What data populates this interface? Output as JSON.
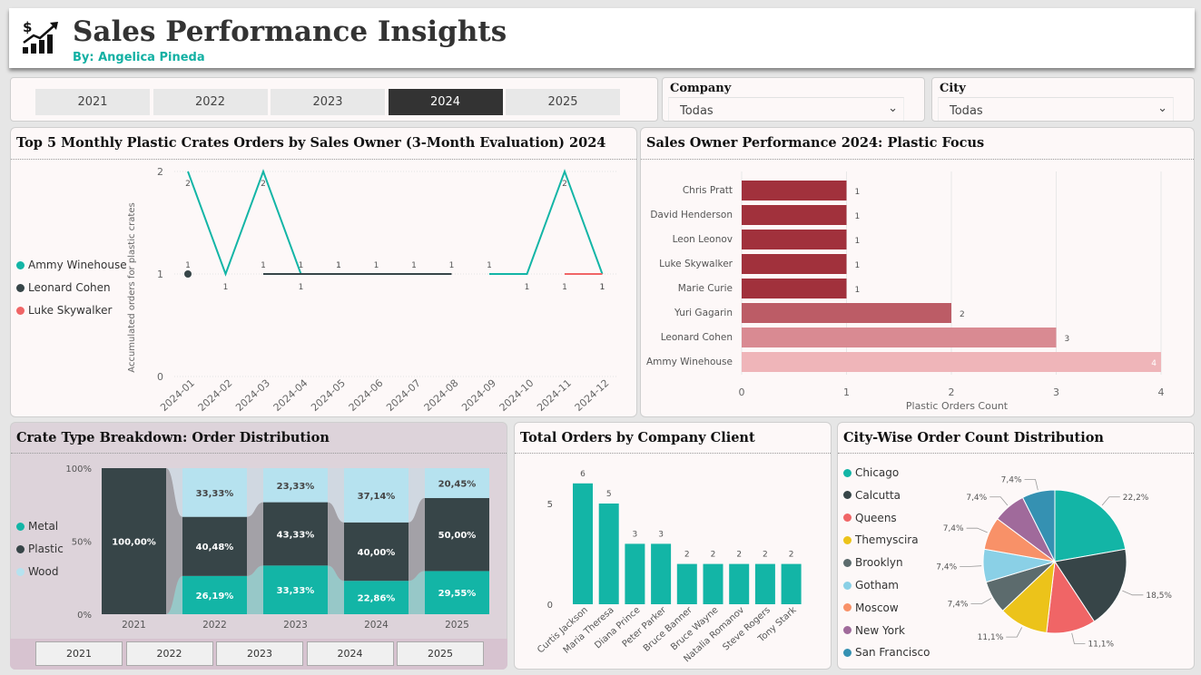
{
  "header": {
    "title": "Sales Performance Insights",
    "subtitle": "By: Angelica Pineda",
    "logo_icon": "sales-growth-icon"
  },
  "year_slicer": {
    "years": [
      "2021",
      "2022",
      "2023",
      "2024",
      "2025"
    ],
    "selected": "2024"
  },
  "company_filter": {
    "label": "Company",
    "value": "Todas"
  },
  "city_filter": {
    "label": "City",
    "value": "Todas"
  },
  "colors": {
    "teal": "#13b5a6",
    "dark": "#374548",
    "coral": "#f06566",
    "bar_dark": "#a1313c",
    "bar_mid": "#bc5c66",
    "bar_light": "#d98a92",
    "bar_lightest": "#efb5b9"
  },
  "line_panel": {
    "title": "Top 5 Monthly Plastic Crates Orders by Sales Owner (3-Month Evaluation) 2024",
    "legend": [
      {
        "name": "Ammy Winehouse",
        "color": "#13b5a6"
      },
      {
        "name": "Leonard Cohen",
        "color": "#374548"
      },
      {
        "name": "Luke Skywalker",
        "color": "#f06566"
      }
    ],
    "chart_data": {
      "type": "line",
      "x": [
        "2024-01",
        "2024-02",
        "2024-03",
        "2024-04",
        "2024-05",
        "2024-06",
        "2024-07",
        "2024-08",
        "2024-09",
        "2024-10",
        "2024-11",
        "2024-12"
      ],
      "ylabel": "Accumulated orders for plastic crates",
      "yticks": [
        "0",
        "1",
        "2"
      ],
      "ylim": [
        0,
        2
      ],
      "series": [
        {
          "name": "Ammy Winehouse",
          "values": [
            2,
            1,
            2,
            1,
            1,
            null,
            null,
            null,
            1,
            1,
            2,
            1
          ]
        },
        {
          "name": "Leonard Cohen",
          "values": [
            1,
            null,
            1,
            1,
            1,
            1,
            1,
            1,
            null,
            null,
            null,
            null
          ]
        },
        {
          "name": "Luke Skywalker",
          "values": [
            null,
            null,
            null,
            null,
            null,
            null,
            null,
            null,
            null,
            null,
            1,
            1
          ]
        }
      ]
    }
  },
  "bar_panel": {
    "title": "Sales Owner Performance 2024: Plastic Focus",
    "chart_data": {
      "type": "bar",
      "categories": [
        "Chris Pratt",
        "David Henderson",
        "Leon Leonov",
        "Luke Skywalker",
        "Marie Curie",
        "Yuri Gagarin",
        "Leonard Cohen",
        "Ammy Winehouse"
      ],
      "values": [
        1,
        1,
        1,
        1,
        1,
        2,
        3,
        4
      ],
      "xlabel": "Plastic Orders Count",
      "xticks": [
        "0",
        "1",
        "2",
        "3",
        "4"
      ],
      "xlim": [
        0,
        4
      ]
    }
  },
  "stack_panel": {
    "title": "Crate Type Breakdown: Order Distribution",
    "legend": [
      {
        "name": "Metal",
        "color": "#13b5a6"
      },
      {
        "name": "Plastic",
        "color": "#374548"
      },
      {
        "name": "Wood",
        "color": "#b6e2ef"
      }
    ],
    "bottom_buttons": [
      "2021",
      "2022",
      "2023",
      "2024",
      "2025"
    ],
    "chart_data": {
      "type": "bar",
      "categories": [
        "2021",
        "2022",
        "2023",
        "2024",
        "2025"
      ],
      "yticks": [
        "100%",
        "50%",
        "0%"
      ],
      "series": [
        {
          "name": "Metal",
          "values": [
            0,
            26.19,
            33.33,
            22.86,
            29.55
          ],
          "labels": [
            "",
            "26,19%",
            "33,33%",
            "22,86%",
            "29,55%"
          ]
        },
        {
          "name": "Plastic",
          "values": [
            100,
            40.48,
            43.33,
            40.0,
            50.0
          ],
          "labels": [
            "100,00%",
            "40,48%",
            "43,33%",
            "40,00%",
            "50,00%"
          ]
        },
        {
          "name": "Wood",
          "values": [
            0,
            33.33,
            23.33,
            37.14,
            20.45
          ],
          "labels": [
            "",
            "33,33%",
            "23,33%",
            "37,14%",
            "20,45%"
          ]
        }
      ]
    }
  },
  "company_panel": {
    "title": "Total Orders by Company Client",
    "chart_data": {
      "type": "bar",
      "categories": [
        "Curtis Jackson",
        "Maria Theresa",
        "Diana Prince",
        "Peter Parker",
        "Bruce Banner",
        "Bruce Wayne",
        "Natalia Romanov",
        "Steve Rogers",
        "Tony Stark"
      ],
      "values": [
        6,
        5,
        3,
        3,
        2,
        2,
        2,
        2,
        2
      ],
      "yticks": [
        "0",
        "5"
      ],
      "ylim": [
        0,
        6.5
      ]
    }
  },
  "pie_panel": {
    "title": "City-Wise Order Count Distribution",
    "chart_data": {
      "type": "pie",
      "labels": [
        "Chicago",
        "Calcutta",
        "Queens",
        "Themyscira",
        "Brooklyn",
        "Gotham",
        "Moscow",
        "New York",
        "San Francisco"
      ],
      "values": [
        22.2,
        18.5,
        11.1,
        11.1,
        7.4,
        7.4,
        7.4,
        7.4,
        7.4
      ],
      "value_labels": [
        "22,2%",
        "18,5%",
        "11,1%",
        "11,1%",
        "7,4%",
        "7,4%",
        "7,4%",
        "7,4%",
        "7,4%"
      ],
      "colors": [
        "#13b5a6",
        "#374548",
        "#f06566",
        "#ecc31a",
        "#5c6b6d",
        "#8ad0e6",
        "#f89168",
        "#a06a9b",
        "#3591b2"
      ]
    }
  }
}
